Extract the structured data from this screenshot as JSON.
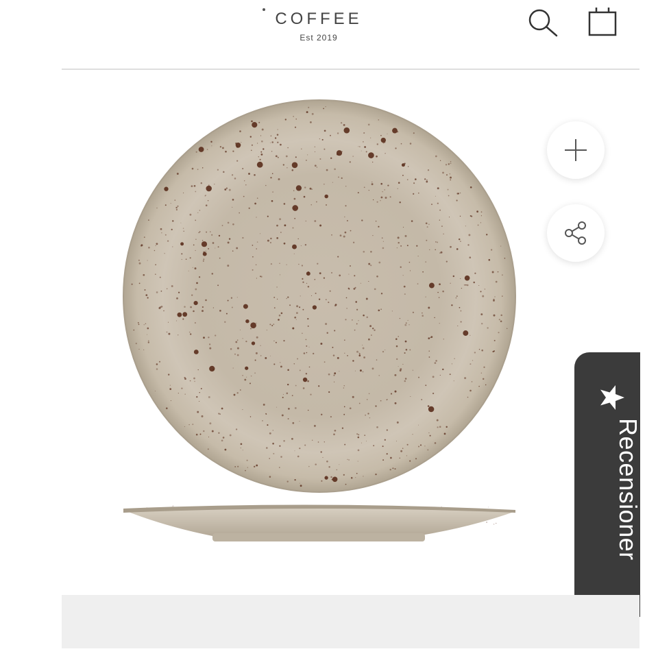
{
  "header": {
    "logo_title": "COFFEE",
    "logo_subtitle": "Est 2019",
    "search_icon": "search-icon",
    "cart_icon": "shopping-bag-icon"
  },
  "product": {
    "image": "speckled-stoneware-plate",
    "actions": [
      {
        "name": "zoom",
        "icon": "plus-icon"
      },
      {
        "name": "share",
        "icon": "share-icon"
      }
    ]
  },
  "reviews_tab": {
    "label": "Recensioner",
    "icon": "star-icon",
    "background": "#3b3b3b"
  },
  "colors": {
    "text": "#444444",
    "plate": "#c4b9a8",
    "speckle": "#5a2e1c",
    "divider": "#dedede",
    "footer_bar": "#efefef"
  }
}
